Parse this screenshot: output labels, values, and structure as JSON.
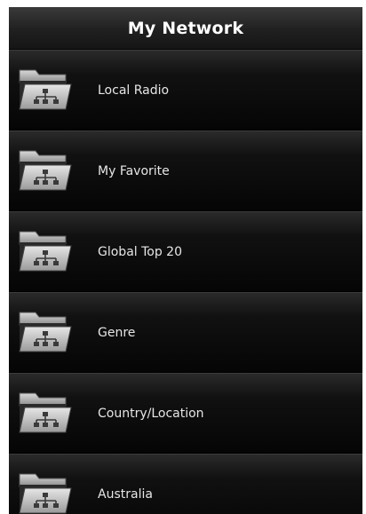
{
  "header": {
    "title": "My Network"
  },
  "items": [
    {
      "label": "Local Radio",
      "icon": "network-folder-icon"
    },
    {
      "label": "My Favorite",
      "icon": "network-folder-icon"
    },
    {
      "label": "Global Top 20",
      "icon": "network-folder-icon"
    },
    {
      "label": "Genre",
      "icon": "network-folder-icon"
    },
    {
      "label": "Country/Location",
      "icon": "network-folder-icon"
    },
    {
      "label": "Australia",
      "icon": "network-folder-icon"
    }
  ],
  "colors": {
    "background": "#0b0b0b",
    "title_text": "#ffffff",
    "item_text": "#e6e6e6",
    "folder": "#bdbdbd"
  }
}
